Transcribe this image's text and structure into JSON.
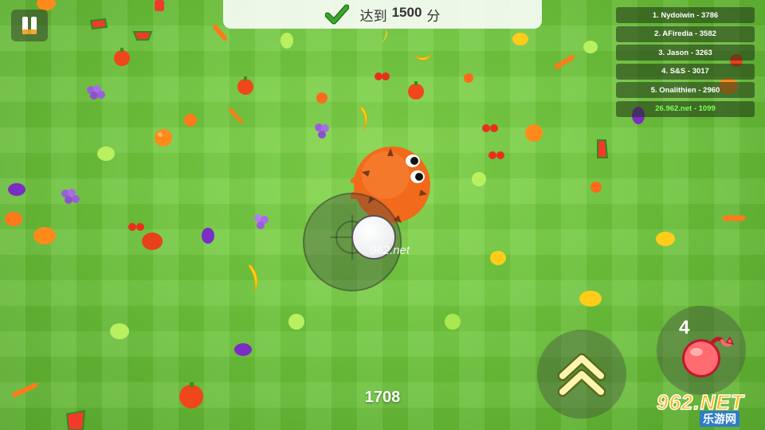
{
  "goal": {
    "prefix": "达到",
    "target": "1500",
    "suffix": "分"
  },
  "leaderboard": [
    {
      "text": "1. Nydoiwin - 3786"
    },
    {
      "text": "2. AFiredia - 3582"
    },
    {
      "text": "3. Jason - 3263"
    },
    {
      "text": "4. S&S - 3017"
    },
    {
      "text": "5. Onalithien - 2960"
    },
    {
      "text": "26.962.net - 1099"
    }
  ],
  "player": {
    "name": "962.net",
    "score": "1708"
  },
  "bomb": {
    "count": "4"
  },
  "watermark": {
    "main": "962.NET",
    "sub": "乐游网"
  },
  "colors": {
    "grass": "#6bc23a",
    "snake": "#f26a1b",
    "highlight": "#7dff5b",
    "check": "#3aa82a"
  },
  "icons": {
    "pause": "pause-icon",
    "check": "check-icon",
    "boost": "double-chevron-up-icon",
    "bomb": "bomb-icon"
  }
}
